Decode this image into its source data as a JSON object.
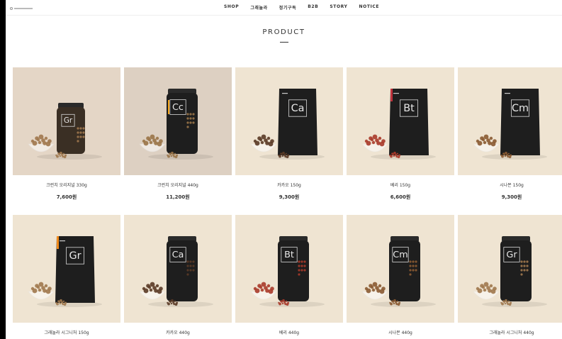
{
  "header": {
    "nav": [
      "SHOP",
      "그래놀라",
      "정기구독",
      "B2B",
      "STORY",
      "NOTICE"
    ]
  },
  "page": {
    "title": "PRODUCT"
  },
  "products": [
    {
      "name": "크런치 오리지널 330g",
      "price": "7,600원",
      "original": "",
      "code": "Gr",
      "package": "jar-small",
      "bg": "#e4d6c6",
      "tag": "",
      "granola": "#a0784e"
    },
    {
      "name": "크런치 오리지널 440g",
      "price": "11,200원",
      "original": "",
      "code": "Cc",
      "package": "jar",
      "bg": "#ddd0c2",
      "tag": "#f4a51c",
      "granola": "#9a7448"
    },
    {
      "name": "카카오 150g",
      "price": "9,300원",
      "original": "",
      "code": "Ca",
      "package": "pouch",
      "bg": "#efe4d2",
      "tag": "",
      "granola": "#5a3a26"
    },
    {
      "name": "베리 150g",
      "price": "6,600원",
      "original": "",
      "code": "Bt",
      "package": "pouch",
      "bg": "#efe4d2",
      "tag": "#c0323c",
      "granola": "#a83a2a"
    },
    {
      "name": "시나몬 150g",
      "price": "9,300원",
      "original": "",
      "code": "Cm",
      "package": "pouch",
      "bg": "#efe4d2",
      "tag": "",
      "granola": "#8a5a32"
    },
    {
      "name": "그래놀라 시그니처 150g",
      "price": "",
      "original": "",
      "code": "Gr",
      "package": "pouch",
      "bg": "#efe4d2",
      "tag": "#f08a1c",
      "granola": "#a0784e"
    },
    {
      "name": "카카오 440g",
      "price": "",
      "original": "",
      "code": "Ca",
      "package": "jar",
      "bg": "#efe4d2",
      "tag": "",
      "granola": "#5a3a26"
    },
    {
      "name": "베리 440g",
      "price": "",
      "original": "",
      "code": "Bt",
      "package": "jar",
      "bg": "#efe4d2",
      "tag": "",
      "granola": "#a83a2a"
    },
    {
      "name": "시나몬 440g",
      "price": "",
      "original": "",
      "code": "Cm",
      "package": "jar",
      "bg": "#efe4d2",
      "tag": "",
      "granola": "#8a5a32"
    },
    {
      "name": "그래놀라 시그니처 440g",
      "price": "",
      "original": "",
      "code": "Gr",
      "package": "jar",
      "bg": "#efe4d2",
      "tag": "",
      "granola": "#a0784e"
    }
  ]
}
